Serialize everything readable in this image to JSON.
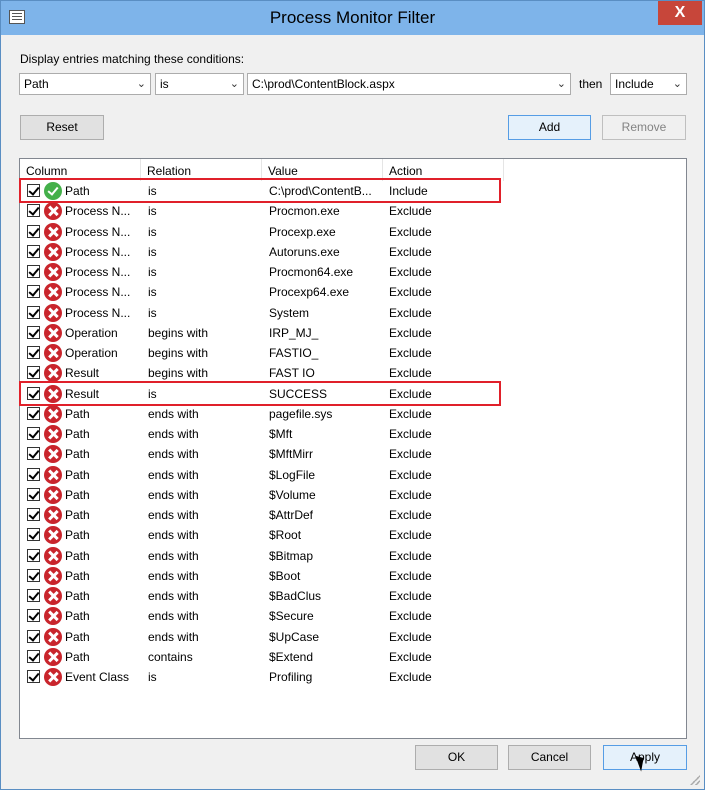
{
  "window": {
    "title": "Process Monitor Filter",
    "close_glyph": "X"
  },
  "filter": {
    "prompt": "Display entries matching these conditions:",
    "column_value": "Path",
    "relation_value": "is",
    "value_value": "C:\\prod\\ContentBlock.aspx",
    "then_label": "then",
    "action_value": "Include"
  },
  "buttons": {
    "reset": "Reset",
    "add": "Add",
    "remove": "Remove",
    "ok": "OK",
    "cancel": "Cancel",
    "apply": "Apply"
  },
  "table": {
    "headers": [
      "Column",
      "Relation",
      "Value",
      "Action"
    ],
    "rows": [
      {
        "column": "Path",
        "relation": "is",
        "value": "C:\\prod\\ContentB...",
        "action": "Include",
        "status": "include"
      },
      {
        "column": "Process N...",
        "relation": "is",
        "value": "Procmon.exe",
        "action": "Exclude",
        "status": "exclude"
      },
      {
        "column": "Process N...",
        "relation": "is",
        "value": "Procexp.exe",
        "action": "Exclude",
        "status": "exclude"
      },
      {
        "column": "Process N...",
        "relation": "is",
        "value": "Autoruns.exe",
        "action": "Exclude",
        "status": "exclude"
      },
      {
        "column": "Process N...",
        "relation": "is",
        "value": "Procmon64.exe",
        "action": "Exclude",
        "status": "exclude"
      },
      {
        "column": "Process N...",
        "relation": "is",
        "value": "Procexp64.exe",
        "action": "Exclude",
        "status": "exclude"
      },
      {
        "column": "Process N...",
        "relation": "is",
        "value": "System",
        "action": "Exclude",
        "status": "exclude"
      },
      {
        "column": "Operation",
        "relation": "begins with",
        "value": "IRP_MJ_",
        "action": "Exclude",
        "status": "exclude"
      },
      {
        "column": "Operation",
        "relation": "begins with",
        "value": "FASTIO_",
        "action": "Exclude",
        "status": "exclude"
      },
      {
        "column": "Result",
        "relation": "begins with",
        "value": "FAST IO",
        "action": "Exclude",
        "status": "exclude"
      },
      {
        "column": "Result",
        "relation": "is",
        "value": "SUCCESS",
        "action": "Exclude",
        "status": "exclude"
      },
      {
        "column": "Path",
        "relation": "ends with",
        "value": "pagefile.sys",
        "action": "Exclude",
        "status": "exclude"
      },
      {
        "column": "Path",
        "relation": "ends with",
        "value": "$Mft",
        "action": "Exclude",
        "status": "exclude"
      },
      {
        "column": "Path",
        "relation": "ends with",
        "value": "$MftMirr",
        "action": "Exclude",
        "status": "exclude"
      },
      {
        "column": "Path",
        "relation": "ends with",
        "value": "$LogFile",
        "action": "Exclude",
        "status": "exclude"
      },
      {
        "column": "Path",
        "relation": "ends with",
        "value": "$Volume",
        "action": "Exclude",
        "status": "exclude"
      },
      {
        "column": "Path",
        "relation": "ends with",
        "value": "$AttrDef",
        "action": "Exclude",
        "status": "exclude"
      },
      {
        "column": "Path",
        "relation": "ends with",
        "value": "$Root",
        "action": "Exclude",
        "status": "exclude"
      },
      {
        "column": "Path",
        "relation": "ends with",
        "value": "$Bitmap",
        "action": "Exclude",
        "status": "exclude"
      },
      {
        "column": "Path",
        "relation": "ends with",
        "value": "$Boot",
        "action": "Exclude",
        "status": "exclude"
      },
      {
        "column": "Path",
        "relation": "ends with",
        "value": "$BadClus",
        "action": "Exclude",
        "status": "exclude"
      },
      {
        "column": "Path",
        "relation": "ends with",
        "value": "$Secure",
        "action": "Exclude",
        "status": "exclude"
      },
      {
        "column": "Path",
        "relation": "ends with",
        "value": "$UpCase",
        "action": "Exclude",
        "status": "exclude"
      },
      {
        "column": "Path",
        "relation": "contains",
        "value": "$Extend",
        "action": "Exclude",
        "status": "exclude"
      },
      {
        "column": "Event Class",
        "relation": "is",
        "value": "Profiling",
        "action": "Exclude",
        "status": "exclude"
      }
    ]
  },
  "colors": {
    "titlebar": "#7eb4ea",
    "highlight": "#e0202a",
    "include": "#44b04a",
    "exclude": "#c9252c"
  }
}
